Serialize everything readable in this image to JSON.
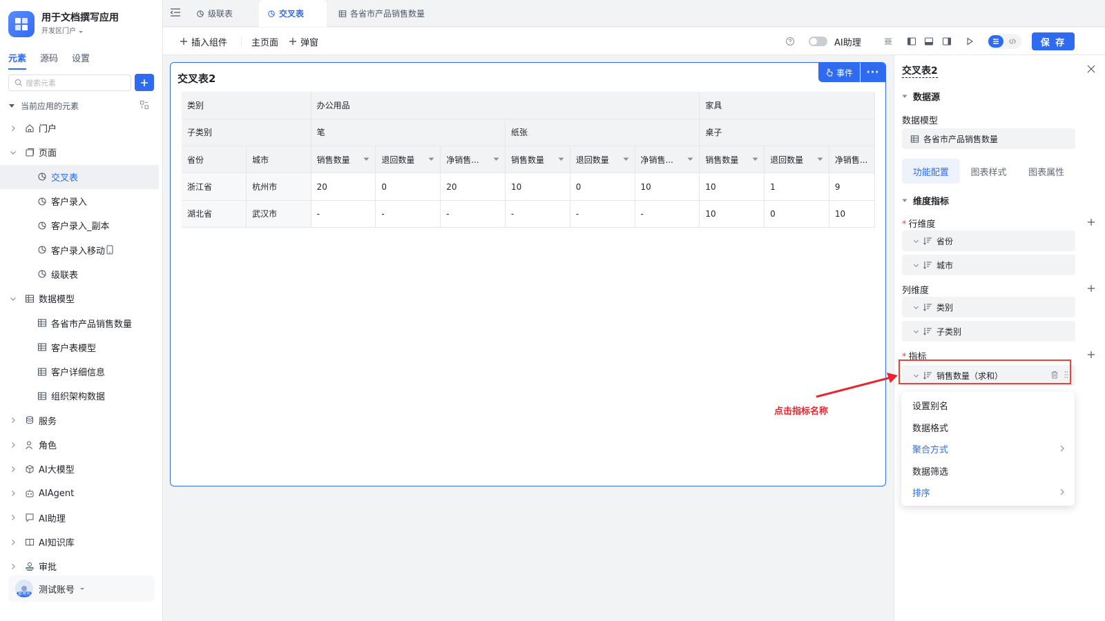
{
  "app": {
    "name": "用于文档撰写应用",
    "portal": "开发区门户"
  },
  "sidebar": {
    "tabs": [
      {
        "label": "元素"
      },
      {
        "label": "源码"
      },
      {
        "label": "设置"
      }
    ],
    "search_placeholder": "搜索元素",
    "section_label": "当前应用的元素",
    "items": [
      {
        "label": "门户"
      },
      {
        "label": "页面"
      },
      {
        "label": "交叉表"
      },
      {
        "label": "客户录入"
      },
      {
        "label": "客户录入_副本"
      },
      {
        "label": "客户录入移动"
      },
      {
        "label": "级联表"
      },
      {
        "label": "数据模型"
      },
      {
        "label": "各省市产品销售数量"
      },
      {
        "label": "客户表模型"
      },
      {
        "label": "客户详细信息"
      },
      {
        "label": "组织架构数据"
      },
      {
        "label": "服务"
      },
      {
        "label": "角色"
      },
      {
        "label": "AI大模型"
      },
      {
        "label": "AIAgent"
      },
      {
        "label": "AI助理"
      },
      {
        "label": "AI知识库"
      },
      {
        "label": "审批"
      }
    ],
    "user": {
      "name": "测试账号",
      "role": "管理员"
    }
  },
  "tabs": [
    {
      "label": "级联表"
    },
    {
      "label": "交叉表"
    },
    {
      "label": "各省市产品销售数量"
    }
  ],
  "toolbar": {
    "insert_label": "插入组件",
    "main_page_label": "主页面",
    "popup_label": "弹窗",
    "ai_label": "AI助理",
    "save_label": "保 存"
  },
  "canvas": {
    "title": "交叉表2",
    "event_label": "事件",
    "more_label": "···",
    "pivot": {
      "category_label": "类别",
      "subcategory_label": "子类别",
      "row_headers": [
        "省份",
        "城市"
      ],
      "categories": [
        {
          "label": "办公用品",
          "subs": [
            "笔",
            "纸张"
          ]
        },
        {
          "label": "家具",
          "subs": [
            "桌子"
          ]
        }
      ],
      "measures": [
        "销售数量",
        "退回数量",
        "净销售..."
      ],
      "rows": [
        {
          "province": "浙江省",
          "city": "杭州市",
          "values": [
            "20",
            "0",
            "20",
            "10",
            "0",
            "10",
            "10",
            "1",
            "9"
          ]
        },
        {
          "province": "湖北省",
          "city": "武汉市",
          "values": [
            "-",
            "-",
            "-",
            "-",
            "-",
            "-",
            "10",
            "0",
            "10"
          ]
        }
      ]
    }
  },
  "panel": {
    "title": "交叉表2",
    "datasource_label": "数据源",
    "model_label": "数据模型",
    "model_value": "各省市产品销售数量",
    "tabs": [
      {
        "label": "功能配置"
      },
      {
        "label": "图表样式"
      },
      {
        "label": "图表属性"
      }
    ],
    "dimension_section": "维度指标",
    "row_dim_label": "行维度",
    "row_dims": [
      "省份",
      "城市"
    ],
    "col_dim_label": "列维度",
    "col_dims": [
      "类别",
      "子类别"
    ],
    "metric_label": "指标",
    "metric_item": "销售数量（求和）",
    "required_mark": "*"
  },
  "menu": {
    "items": [
      {
        "label": "设置别名",
        "submenu": false
      },
      {
        "label": "数据格式",
        "submenu": false
      },
      {
        "label": "聚合方式",
        "submenu": true
      },
      {
        "label": "数据筛选",
        "submenu": false
      },
      {
        "label": "排序",
        "submenu": true
      }
    ]
  },
  "annotation": {
    "text": "点击指标名称"
  },
  "colors": {
    "accent": "#2f6bf1",
    "annotation": "#e8262b"
  }
}
